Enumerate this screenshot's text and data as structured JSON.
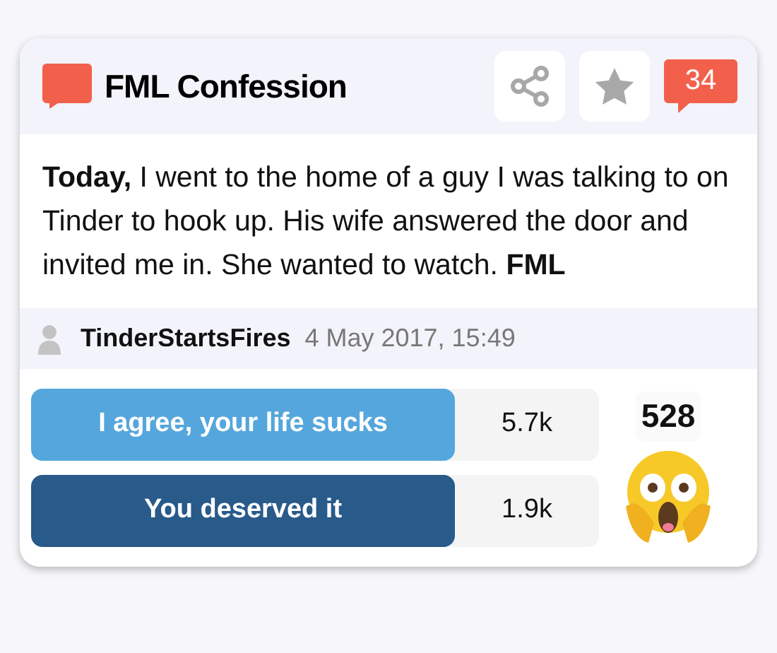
{
  "header": {
    "title": "FML Confession",
    "comment_count": "34"
  },
  "story": "**Today,** I went to the home of a guy I was talking to on Tinder to hook up. His wife answered the door and invited me in. She wanted to watch. **FML**",
  "author": {
    "name": "TinderStartsFires",
    "date": "4 May 2017, 15:49"
  },
  "votes": [
    {
      "label": "I agree, your life sucks",
      "count": "5.7k",
      "color": "#55a6dc"
    },
    {
      "label": "You deserved it",
      "count": "1.9k",
      "color": "#285a8a"
    }
  ],
  "reaction": {
    "count": "528"
  }
}
